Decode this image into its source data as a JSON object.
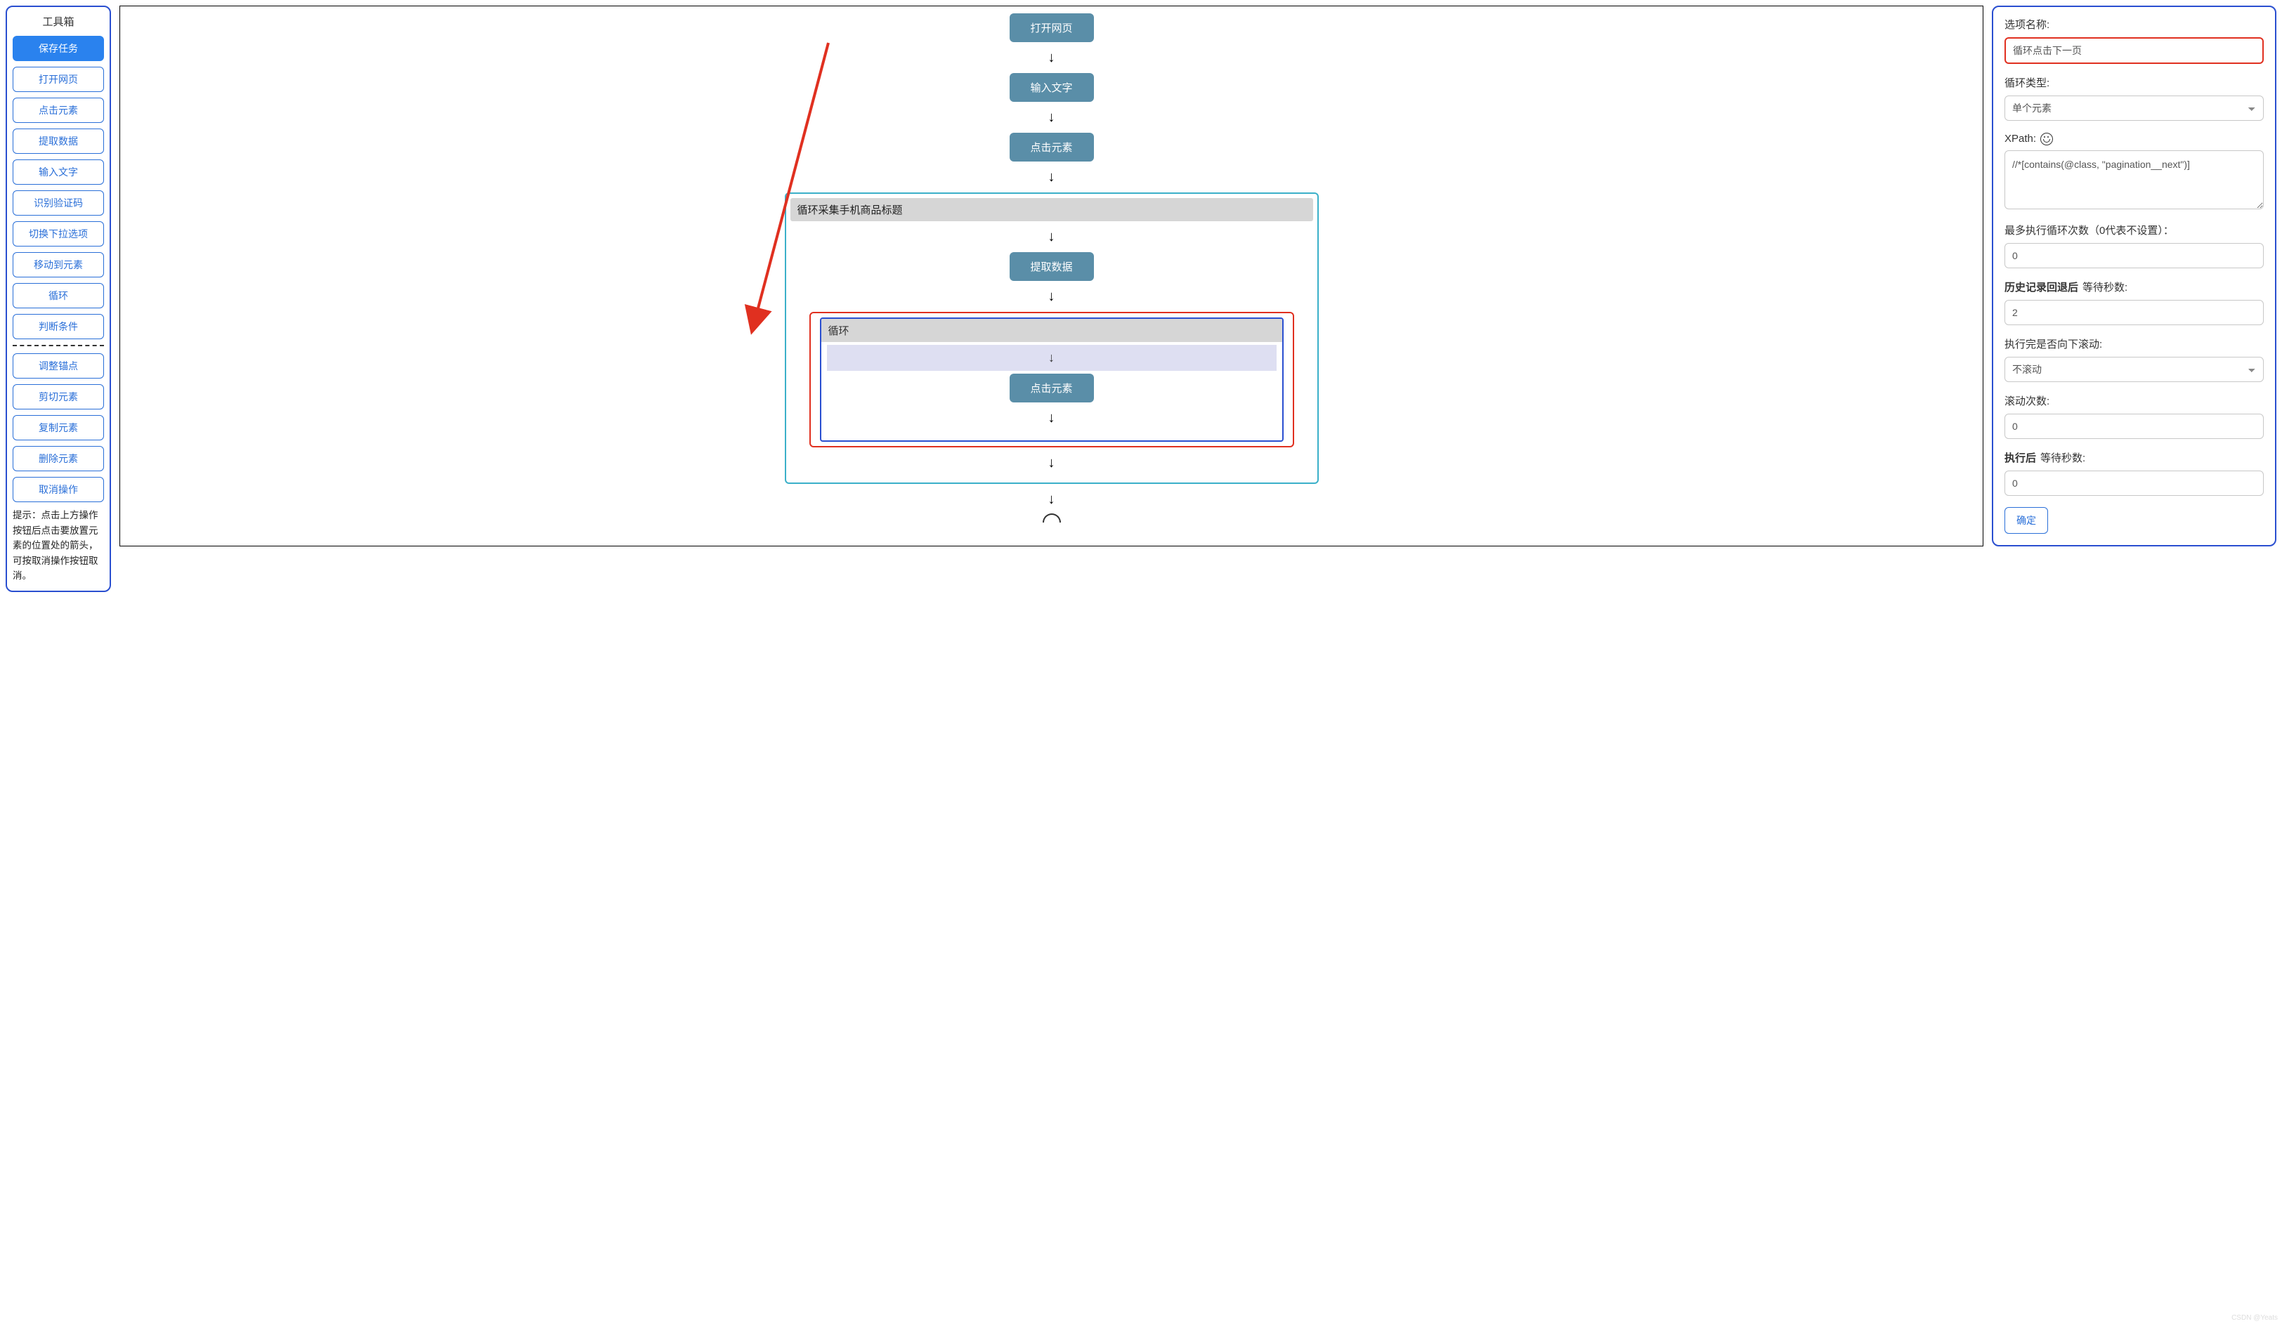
{
  "toolbox": {
    "title": "工具箱",
    "primary": "保存任务",
    "group1": [
      "打开网页",
      "点击元素",
      "提取数据",
      "输入文字",
      "识别验证码",
      "切换下拉选项",
      "移动到元素",
      "循环",
      "判断条件"
    ],
    "group2": [
      "调整锚点",
      "剪切元素",
      "复制元素",
      "删除元素",
      "取消操作"
    ],
    "hint": "提示：点击上方操作按钮后点击要放置元素的位置处的箭头，可按取消操作按钮取消。"
  },
  "flow": {
    "nodes": [
      "打开网页",
      "输入文字",
      "点击元素"
    ],
    "loop1_title": "循环采集手机商品标题",
    "loop1_inner_node": "提取数据",
    "loop2_title": "循环",
    "loop2_inner_node": "点击元素"
  },
  "panel": {
    "name_label": "选项名称:",
    "name_value": "循环点击下一页",
    "type_label": "循环类型:",
    "type_value": "单个元素",
    "xpath_label": "XPath:",
    "xpath_value": "//*[contains(@class, \"pagination__next\")]",
    "max_loop_label": "最多执行循环次数（0代表不设置）：",
    "max_loop_value": "0",
    "history_wait_label_bold": "历史记录回退后",
    "history_wait_label_rest": "等待秒数:",
    "history_wait_value": "2",
    "scroll_label": "执行完是否向下滚动:",
    "scroll_value": "不滚动",
    "scroll_count_label": "滚动次数:",
    "scroll_count_value": "0",
    "after_wait_label_bold": "执行后",
    "after_wait_label_rest": "等待秒数:",
    "after_wait_value": "0",
    "confirm": "确定"
  }
}
